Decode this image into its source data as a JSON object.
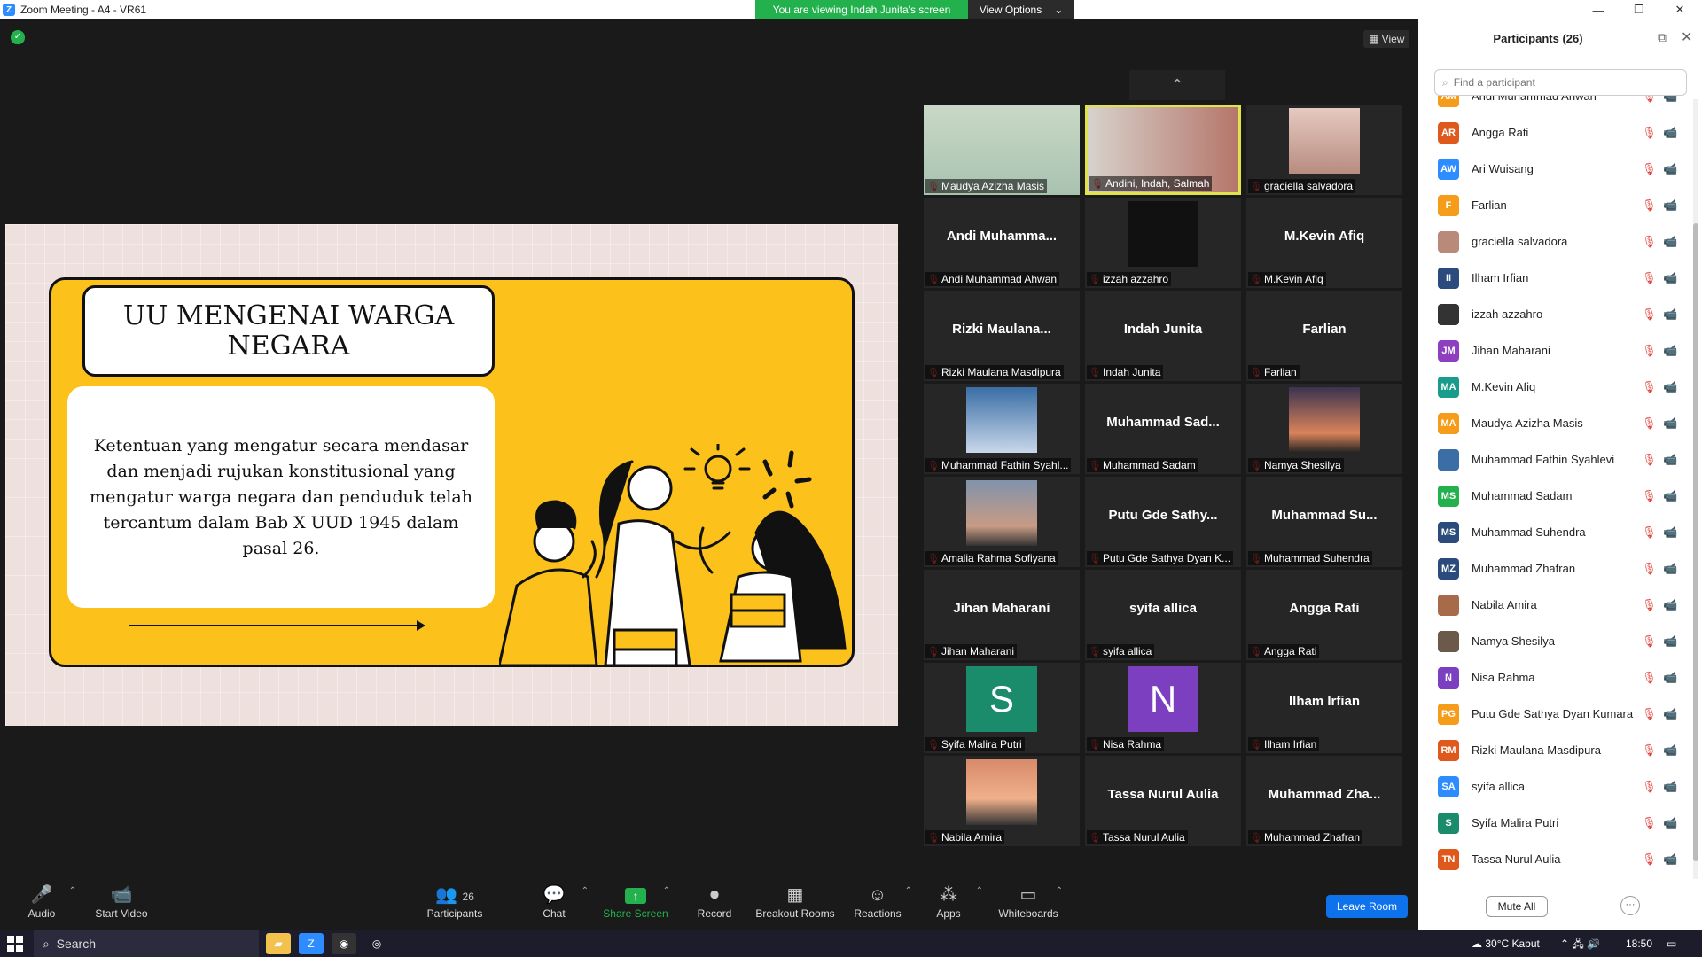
{
  "window": {
    "title": "Zoom Meeting - A4 - VR61"
  },
  "banner": {
    "viewing": "You are viewing Indah Junita's screen",
    "view_options": "View Options"
  },
  "view_button": "View",
  "slide": {
    "title": "UU MENGENAI WARGA NEGARA",
    "body": "Ketentuan yang mengatur secara mendasar dan menjadi rujukan konstitusional yang mengatur warga negara dan penduduk telah tercantum dalam Bab X UUD 1945 dalam pasal 26."
  },
  "tiles": [
    {
      "big": "",
      "label": "Maudya Azizha Masis",
      "thumb": "photo-girl"
    },
    {
      "big": "",
      "label": "Andini, Indah, Salmah",
      "thumb": "photo-pair",
      "active": true
    },
    {
      "big": "",
      "label": "graciella salvadora",
      "thumb": "photo-face"
    },
    {
      "big": "Andi  Muhamma...",
      "label": "Andi Muhammad Ahwan"
    },
    {
      "big": "",
      "label": "izzah azzahro",
      "thumb": "photo-dark"
    },
    {
      "big": "M.Kevin Afiq",
      "label": "M.Kevin Afiq"
    },
    {
      "big": "Rizki  Maulana...",
      "label": "Rizki Maulana Masdipura"
    },
    {
      "big": "Indah Junita",
      "label": "Indah Junita"
    },
    {
      "big": "Farlian",
      "label": "Farlian"
    },
    {
      "big": "",
      "label": "Muhammad Fathin Syahl...",
      "thumb": "photo-man"
    },
    {
      "big": "Muhammad  Sad...",
      "label": "Muhammad Sadam"
    },
    {
      "big": "",
      "label": "Namya Shesilya",
      "thumb": "photo-sunset"
    },
    {
      "big": "",
      "label": "Amalia Rahma Sofiyana",
      "thumb": "photo-city"
    },
    {
      "big": "Putu Gde Sathy...",
      "label": "Putu Gde Sathya Dyan K..."
    },
    {
      "big": "Muhammad  Su...",
      "label": "Muhammad Suhendra"
    },
    {
      "big": "Jihan Maharani",
      "label": "Jihan Maharani"
    },
    {
      "big": "syifa allica",
      "label": "syifa allica"
    },
    {
      "big": "Angga Rati",
      "label": "Angga Rati"
    },
    {
      "big": "",
      "label": "Syifa Malira Putri",
      "letter": "S",
      "letter_color": "#1a8c6c"
    },
    {
      "big": "",
      "label": "Nisa Rahma",
      "letter": "N",
      "letter_color": "#7b3fbf"
    },
    {
      "big": "Ilham Irfian",
      "label": "Ilham Irfian"
    },
    {
      "big": "",
      "label": "Nabila Amira",
      "thumb": "photo-dusk"
    },
    {
      "big": "Tassa Nurul Aulia",
      "label": "Tassa Nurul Aulia"
    },
    {
      "big": "Muhammad  Zha...",
      "label": "Muhammad Zhafran"
    }
  ],
  "toolbar": {
    "audio": "Audio",
    "start_video": "Start Video",
    "participants": "Participants",
    "participants_count": "26",
    "chat": "Chat",
    "share_screen": "Share Screen",
    "record": "Record",
    "breakout": "Breakout Rooms",
    "reactions": "Reactions",
    "apps": "Apps",
    "whiteboards": "Whiteboards",
    "leave": "Leave Room"
  },
  "panel": {
    "title": "Participants (26)",
    "search_placeholder": "Find a participant",
    "mute_all": "Mute All",
    "more": "···",
    "participants": [
      {
        "initials": "AM",
        "name": "Andi Muhammad Ahwan",
        "color": "#f59c1a",
        "video_on": false
      },
      {
        "initials": "AR",
        "name": "Angga Rati",
        "color": "#e0591c",
        "video_on": false
      },
      {
        "initials": "AW",
        "name": "Ari Wuisang",
        "color": "#2d8cff",
        "video_on": true
      },
      {
        "initials": "F",
        "name": "Farlian",
        "color": "#f59c1a",
        "video_on": false
      },
      {
        "initials": "",
        "name": "graciella salvadora",
        "color": "#b98a7a",
        "video_on": false
      },
      {
        "initials": "II",
        "name": "Ilham Irfian",
        "color": "#2a4b7c",
        "video_on": false
      },
      {
        "initials": "",
        "name": "izzah azzahro",
        "color": "#333333",
        "video_on": false
      },
      {
        "initials": "JM",
        "name": "Jihan Maharani",
        "color": "#8e3fbf",
        "video_on": false
      },
      {
        "initials": "MA",
        "name": "M.Kevin Afiq",
        "color": "#1a9c8c",
        "video_on": false
      },
      {
        "initials": "MA",
        "name": "Maudya Azizha Masis",
        "color": "#f59c1a",
        "video_on": true
      },
      {
        "initials": "",
        "name": "Muhammad Fathin Syahlevi",
        "color": "#3a6ea5",
        "video_on": false
      },
      {
        "initials": "MS",
        "name": "Muhammad Sadam",
        "color": "#23b14d",
        "video_on": false
      },
      {
        "initials": "MS",
        "name": "Muhammad Suhendra",
        "color": "#2a4b7c",
        "video_on": false
      },
      {
        "initials": "MZ",
        "name": "Muhammad Zhafran",
        "color": "#2a4b7c",
        "video_on": false
      },
      {
        "initials": "",
        "name": "Nabila Amira",
        "color": "#a86b4a",
        "video_on": false
      },
      {
        "initials": "",
        "name": "Namya Shesilya",
        "color": "#6b5a4a",
        "video_on": false
      },
      {
        "initials": "N",
        "name": "Nisa Rahma",
        "color": "#7b3fbf",
        "video_on": false
      },
      {
        "initials": "PG",
        "name": "Putu Gde Sathya Dyan Kumara",
        "color": "#f59c1a",
        "video_on": false
      },
      {
        "initials": "RM",
        "name": "Rizki Maulana Masdipura",
        "color": "#e0591c",
        "video_on": false
      },
      {
        "initials": "SA",
        "name": "syifa allica",
        "color": "#2d8cff",
        "video_on": false
      },
      {
        "initials": "S",
        "name": "Syifa Malira Putri",
        "color": "#1a8c6c",
        "video_on": false
      },
      {
        "initials": "TN",
        "name": "Tassa Nurul Aulia",
        "color": "#e0591c",
        "video_on": false
      }
    ]
  },
  "taskbar": {
    "search": "Search",
    "weather": "30°C  Kabut",
    "time": "18:50"
  }
}
